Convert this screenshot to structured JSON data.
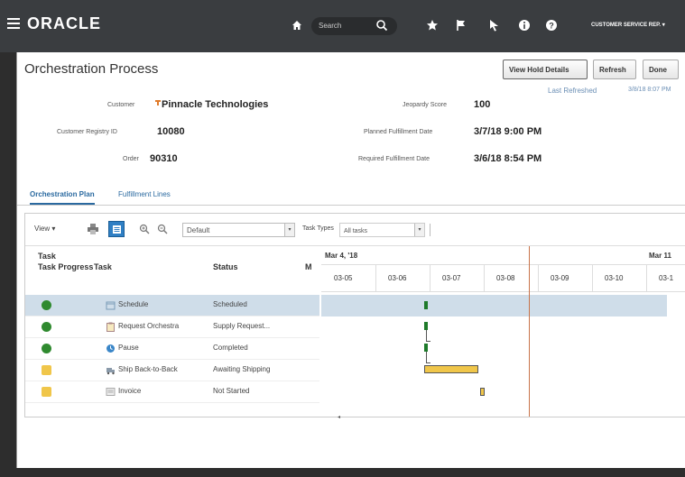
{
  "header": {
    "logo": "ORACLE",
    "search_placeholder": "Search",
    "user_menu": "CUSTOMER SERVICE REP. ▾"
  },
  "page": {
    "title": "Orchestration Process",
    "buttons": {
      "view_hold": "View Hold Details",
      "refresh": "Refresh",
      "done": "Done"
    },
    "last_refreshed_label": "Last Refreshed",
    "last_refreshed_value": "3/8/18 8:07 PM"
  },
  "details": {
    "customer_label": "Customer",
    "customer_value": "Pinnacle Technologies",
    "registry_label": "Customer Registry ID",
    "registry_value": "10080",
    "order_label": "Order",
    "order_value": "90310",
    "jeopardy_label": "Jeopardy Score",
    "jeopardy_value": "100",
    "planned_label": "Planned Fulfillment Date",
    "planned_value": "3/7/18 9:00 PM",
    "required_label": "Required Fulfillment Date",
    "required_value": "3/6/18 8:54 PM"
  },
  "tabs": {
    "active": "Orchestration Plan",
    "inactive": "Fulfillment Lines"
  },
  "toolbar": {
    "view": "View ▾",
    "zoom_select": "Default",
    "task_types_label": "Task Types",
    "task_types_value": "All tasks"
  },
  "table": {
    "headers": {
      "progress": "Task Progress",
      "task": "Task",
      "status": "Status",
      "m": "M"
    },
    "rows": [
      {
        "task": "Schedule",
        "status": "Scheduled",
        "progress": "done"
      },
      {
        "task": "Request Orchestra",
        "status": "Supply Request...",
        "progress": "done"
      },
      {
        "task": "Pause",
        "status": "Completed",
        "progress": "done"
      },
      {
        "task": "Ship Back-to-Back",
        "status": "Awaiting Shipping",
        "progress": "wait"
      },
      {
        "task": "Invoice",
        "status": "Not Started",
        "progress": "wait"
      }
    ]
  },
  "timeline": {
    "week_label_1": "Mar 4, '18",
    "week_label_2": "Mar 11",
    "days": [
      "03-05",
      "03-06",
      "03-07",
      "03-08",
      "03-09",
      "03-10",
      "03-1"
    ]
  },
  "colors": {
    "accent": "#2b6aa0",
    "done": "#2f8a2f",
    "pending": "#f0c64a",
    "today": "#c8734a"
  }
}
